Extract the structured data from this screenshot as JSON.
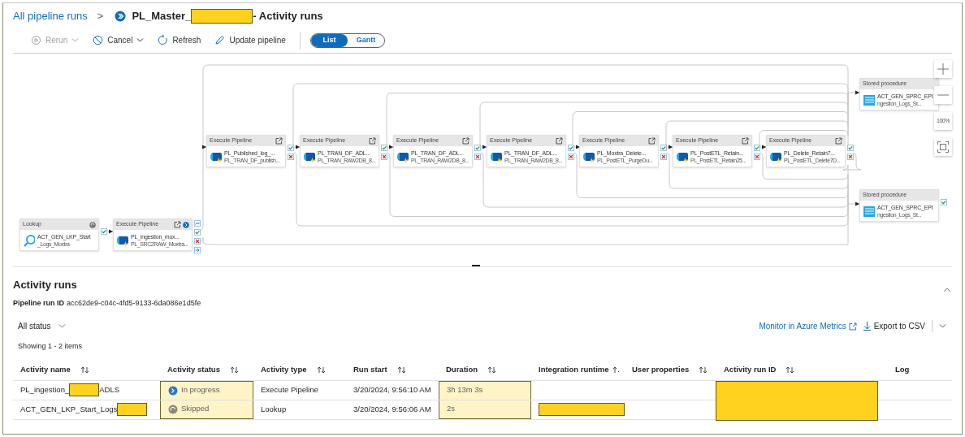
{
  "breadcrumb": {
    "link": "All pipeline runs",
    "separator": ">",
    "title_segments": [
      {
        "kind": "text",
        "text": "PL_Master_"
      },
      {
        "kind": "redacted"
      },
      {
        "kind": "text",
        "text": "- Activity runs"
      }
    ]
  },
  "toolbar": [
    {
      "kind": "rerun",
      "label": "Rerun",
      "disabled": true,
      "dropdown": true
    },
    {
      "kind": "cancel",
      "label": "Cancel",
      "disabled": false,
      "dropdown": true
    },
    {
      "kind": "refresh",
      "label": "Refresh",
      "disabled": false,
      "dropdown": false
    },
    {
      "kind": "edit",
      "label": "Update pipeline",
      "disabled": false,
      "dropdown": false
    }
  ],
  "view_toggle": [
    {
      "label": "List",
      "selected": true
    },
    {
      "label": "Gantt",
      "selected": false
    }
  ],
  "nodes": [
    {
      "kind": "lookup",
      "header": "Lookup",
      "name": "ACT_GEN_LKP_Start",
      "subtitle": "_Logs_Moxtra",
      "running": false
    },
    {
      "kind": "execute_pipeline",
      "header": "Execute Pipeline",
      "name": "PL_ingestion_mox...",
      "subtitle": "PL_SRC2RAW_Moxtra...",
      "running": true
    },
    {
      "kind": "execute_pipeline",
      "header": "Execute Pipeline",
      "name": "PL_Published_log_...",
      "subtitle": "PL_TRAN_DF_publish...",
      "running": false
    },
    {
      "kind": "execute_pipeline",
      "header": "Execute Pipeline",
      "name": "PL_TRAN_DF_ADL...",
      "subtitle": "PL_TRAN_RAW2DB_8...",
      "running": false
    },
    {
      "kind": "execute_pipeline",
      "header": "Execute Pipeline",
      "name": "PL_TRAN_DF_ADL...",
      "subtitle": "PL_TRAN_RAW2DB_8...",
      "running": false
    },
    {
      "kind": "execute_pipeline",
      "header": "Execute Pipeline",
      "name": "PL_TRAN_DF_ADL...",
      "subtitle": "PL_TRAN_RAW2DB_8...",
      "running": false
    },
    {
      "kind": "execute_pipeline",
      "header": "Execute Pipeline",
      "name": "PL_Moxtra_Delete...",
      "subtitle": "PL_PostETL_PurgeDu...",
      "running": false
    },
    {
      "kind": "execute_pipeline",
      "header": "Execute Pipeline",
      "name": "PL_PostETL_Retain...",
      "subtitle": "PL_PostETL_Retain25...",
      "running": false
    },
    {
      "kind": "execute_pipeline",
      "header": "Execute Pipeline",
      "name": "PL_Delete_Retain7...",
      "subtitle": "PL_PostETL_Delete7D...",
      "running": false
    },
    {
      "kind": "stored_procedure",
      "header": "Stored procedure",
      "name": "ACT_GEN_SPRC_EPI",
      "subtitle": "ngestion_Logs_St...",
      "running": false
    },
    {
      "kind": "stored_procedure",
      "header": "Stored procedure",
      "name": "ACT_GEN_SPRC_EPI",
      "subtitle": "ngestion_Logs_St...",
      "running": false
    }
  ],
  "canvas_controls": [
    {
      "kind": "zoom_in"
    },
    {
      "kind": "zoom_out"
    },
    {
      "kind": "zoom_100",
      "label": "100%"
    },
    {
      "kind": "fit"
    }
  ],
  "activity_runs": {
    "title": "Activity runs",
    "run_id_label": "Pipeline run ID",
    "run_id": "acc62de9-c04c-4fd5-9133-6da086e1d5fe",
    "status_filter": "All status",
    "monitor_link": "Monitor in Azure Metrics",
    "export": "Export to CSV",
    "showing": "Showing 1 - 2 items"
  },
  "table": {
    "columns": [
      {
        "label": "Activity name",
        "sortable": true,
        "sorted_ascending": false,
        "highlighted": false
      },
      {
        "label": "Activity status",
        "sortable": true,
        "sorted_ascending": false,
        "highlighted": true
      },
      {
        "label": "Activity type",
        "sortable": true,
        "sorted_ascending": false,
        "highlighted": false
      },
      {
        "label": "Run start",
        "sortable": true,
        "sorted_ascending": false,
        "highlighted": false
      },
      {
        "label": "Duration",
        "sortable": true,
        "sorted_ascending": false,
        "highlighted": true
      },
      {
        "label": "Integration runtime",
        "sortable": true,
        "sorted_ascending": true,
        "highlighted": false
      },
      {
        "label": "User properties",
        "sortable": true,
        "sorted_ascending": false,
        "highlighted": false
      },
      {
        "label": "Activity run ID",
        "sortable": true,
        "sorted_ascending": false,
        "highlighted": false
      },
      {
        "label": "Log",
        "sortable": false,
        "highlighted": false
      }
    ],
    "activity_run_id_redacted": true,
    "rows": [
      {
        "name_segments": [
          {
            "kind": "text",
            "text": "PL_ingestion_"
          },
          {
            "kind": "redacted"
          },
          {
            "kind": "text",
            "text": "ADLS"
          }
        ],
        "status": {
          "kind": "in_progress",
          "text": "In progress"
        },
        "type": "Execute Pipeline",
        "run_start": "3/20/2024, 9:56:10 AM",
        "duration": "3h 13m 3s",
        "runtime_redacted": false
      },
      {
        "name_segments": [
          {
            "kind": "text",
            "text": "ACT_GEN_LKP_Start_Logs"
          },
          {
            "kind": "redacted"
          }
        ],
        "status": {
          "kind": "skipped",
          "text": "Skipped"
        },
        "type": "Lookup",
        "run_start": "3/20/2024, 9:56:06 AM",
        "duration": "2s",
        "runtime_redacted": true
      }
    ]
  }
}
